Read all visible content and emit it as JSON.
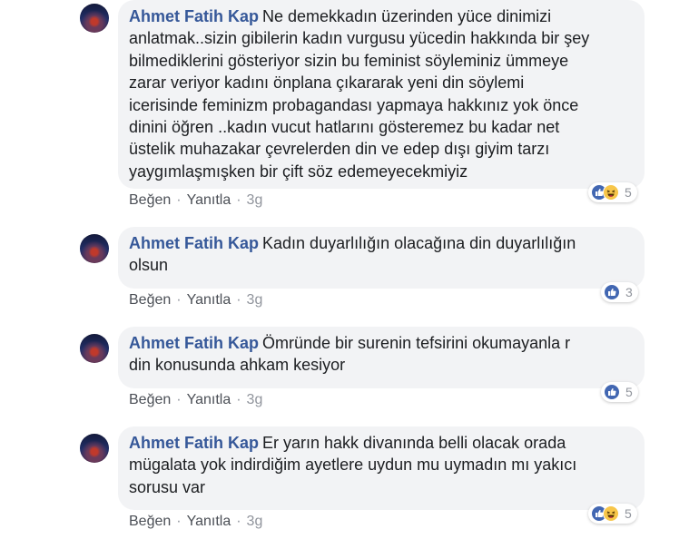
{
  "comments": [
    {
      "author": "Ahmet Fatih Kap",
      "text_lines": [
        "Ne demekkadın üzerinden yüce dinimizi",
        "anlatmak..sizin gibilerin kadın vurgusu yücedin hakkında bir şey",
        "bilmediklerini gösteriyor sizin bu feminist söyleminiz ümmeye",
        "zarar veriyor kadını önplana çıkararak yeni din söylemi",
        "icerisinde feminizm probagandası yapmaya hakkınız yok önce",
        "dinini öğren ..kadın vucut hatlarını gösteremez bu kadar net",
        "üstelik muhazakar çevrelerden din ve edep dışı giyim tarzı",
        "yaygımlaşmışken bir çift söz edemeyecekmiyiz"
      ],
      "reactions": [
        "like",
        "haha"
      ],
      "reaction_count": "5",
      "like_label": "Beğen",
      "reply_label": "Yanıtla",
      "time": "3g"
    },
    {
      "author": "Ahmet Fatih Kap",
      "text_lines": [
        "Kadın duyarlılığın olacağına din duyarlılığın",
        "olsun"
      ],
      "reactions": [
        "like"
      ],
      "reaction_count": "3",
      "like_label": "Beğen",
      "reply_label": "Yanıtla",
      "time": "3g"
    },
    {
      "author": "Ahmet Fatih Kap",
      "text_lines": [
        "Ömründe bir surenin tefsirini okumayanla r",
        "din konusunda ahkam kesiyor"
      ],
      "reactions": [
        "like"
      ],
      "reaction_count": "5",
      "like_label": "Beğen",
      "reply_label": "Yanıtla",
      "time": "3g"
    },
    {
      "author": "Ahmet Fatih Kap",
      "text_lines": [
        "Er yarın hakk divanında belli olacak orada",
        "mügalata yok indirdiğim ayetlere uydun mu uymadın mı yakıcı",
        "sorusu var"
      ],
      "reactions": [
        "like",
        "haha"
      ],
      "reaction_count": "5",
      "like_label": "Beğen",
      "reply_label": "Yanıtla",
      "time": "3g"
    }
  ],
  "colors": {
    "author": "#365899",
    "bubble": "#f2f3f5",
    "like": "#4267b2",
    "haha": "#f7c64a",
    "meta": "#90949c"
  }
}
